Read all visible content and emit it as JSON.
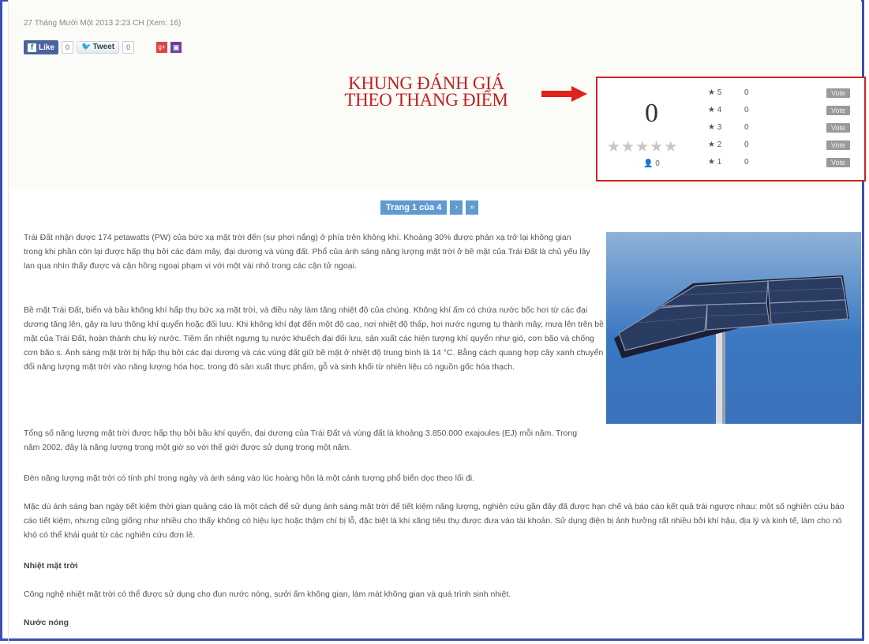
{
  "article": {
    "date_line": "27 Tháng Mười Một 2013 2:23 CH (Xem: 16)"
  },
  "social": {
    "like_label": "Like",
    "like_count": "0",
    "tweet_label": "Tweet",
    "tweet_count": "0",
    "gplus_icon": "google-plus-icon",
    "save_icon": "save-icon"
  },
  "annotation": {
    "line1": "KHUNG ĐÁNH GIÁ",
    "line2": "THEO THANG ĐIỂM",
    "color": "#c0201e"
  },
  "rating": {
    "average": "0",
    "user_count": "0",
    "rows": [
      {
        "stars": "5",
        "count": "0",
        "vote_label": "Vote"
      },
      {
        "stars": "4",
        "count": "0",
        "vote_label": "Vote"
      },
      {
        "stars": "3",
        "count": "0",
        "vote_label": "Vote"
      },
      {
        "stars": "2",
        "count": "0",
        "vote_label": "Vote"
      },
      {
        "stars": "1",
        "count": "0",
        "vote_label": "Vote"
      }
    ]
  },
  "pagination": {
    "label": "Trang 1 của 4",
    "next": "›",
    "last": "»"
  },
  "body": {
    "p1": "Trái Đất nhận được 174 petawatts (PW) của bức xạ mặt trời đến (sự phơi nắng) ở phía trên không khí. Khoảng 30% được phản xạ trở lại không gian trong khi phần còn lại được hấp thụ bởi các đám mây, đại dương và vùng đất. Phổ của ánh sáng năng lượng mặt trời ở bề mặt của Trái Đất là chủ yếu lây lan qua nhìn thấy được và cận hồng ngoại phạm vi với một vài nhỏ trong các cận tử ngoại.",
    "p2": "Bề mặt Trái Đất, biển và bầu không khí hấp thụ bức xạ mặt trời, và điều này làm tăng nhiệt độ của chúng. Không khí ấm có chứa nước bốc hơi từ các đại dương tăng lên, gây ra lưu thông khí quyển hoặc đối lưu. Khi không khí đạt đến một độ cao, nơi nhiệt độ thấp, hơi nước ngưng tụ thành mây, mưa lên trên bề mặt của Trái Đất, hoàn thành chu kỳ nước. Tiềm ẩn nhiệt ngưng tụ nước khuếch đại đối lưu, sản xuất các hiện tượng khí quyển như gió, cơn bão và chống cơn bão s. Ánh sáng mặt trời bị hấp thụ bởi các đại dương và các vùng đất giữ bề mặt ở nhiệt độ trung bình là 14 °C. Bằng cách quang hợp cây xanh chuyển đổi năng lượng mặt trời vào năng lượng hóa học, trong đó sản xuất thực phẩm, gỗ và sinh khối từ nhiên liệu có nguồn gốc hóa thạch.",
    "p3": "Tổng số năng lượng mặt trời được hấp thụ bởi bầu khí quyển, đại dương của Trái Đất và vùng đất là khoảng 3.850.000 exajoules (EJ) mỗi năm. Trong năm 2002, đây là năng lượng trong một giờ so với thế giới được sử dụng trong một năm.",
    "p4": "Đèn năng lượng mặt trời có tính phí trong ngày và ánh sáng vào lúc hoàng hôn là một cảnh tượng phổ biến dọc theo lối đi.",
    "p5": "Mặc dù ánh sáng ban ngày tiết kiệm thời gian quảng cáo là một cách để sử dụng ánh sáng mặt trời để tiết kiệm năng lượng, nghiên cứu gần đây đã được hạn chế và báo cáo kết quả trái ngược nhau: một số nghiên cứu báo cáo tiết kiệm, nhưng cũng giống như nhiều cho thấy không có hiệu lực hoặc thậm chí bị lỗ, đặc biệt là khi xăng tiêu thụ được đưa vào tài khoản. Sử dụng điện bị ảnh hưởng rất nhiều bởi khí hậu, địa lý và kinh tế, làm cho nó khó có thể khái quát từ các nghiên cứu đơn lẻ.",
    "h1": "Nhiệt mặt trời",
    "p6": "Công nghệ nhiệt mặt trời có thể được sử dụng cho đun nước nóng, sưởi ấm không gian, làm mát không gian và quá trình sinh nhiệt.",
    "h2": "Nước nóng"
  }
}
